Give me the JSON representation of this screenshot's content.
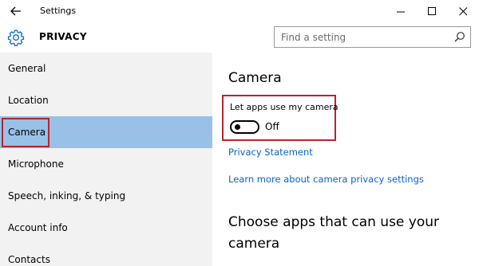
{
  "window": {
    "title": "Settings",
    "controls": {
      "minimize": "minimize",
      "maximize": "maximize",
      "close": "close"
    }
  },
  "header": {
    "section": "PRIVACY",
    "search": {
      "placeholder": "Find a setting",
      "value": ""
    }
  },
  "sidebar": {
    "items": [
      {
        "label": "General",
        "selected": false
      },
      {
        "label": "Location",
        "selected": false
      },
      {
        "label": "Camera",
        "selected": true
      },
      {
        "label": "Microphone",
        "selected": false
      },
      {
        "label": "Speech, inking, & typing",
        "selected": false
      },
      {
        "label": "Account info",
        "selected": false
      },
      {
        "label": "Contacts",
        "selected": false
      }
    ]
  },
  "content": {
    "heading": "Camera",
    "toggle": {
      "label": "Let apps use my camera",
      "state": "Off",
      "on": false
    },
    "links": {
      "privacy_statement": "Privacy Statement",
      "learn_more": "Learn more about camera privacy settings"
    },
    "apps_heading": "Choose apps that can use your camera"
  },
  "colors": {
    "accent": "#0b63c2",
    "selected_nav": "#99c1e7",
    "sidebar_bg": "#f2f2f2",
    "highlight_box": "#b3262d"
  },
  "icons": [
    "back-arrow-icon",
    "gear-icon",
    "search-icon",
    "minimize-icon",
    "maximize-icon",
    "close-icon"
  ]
}
